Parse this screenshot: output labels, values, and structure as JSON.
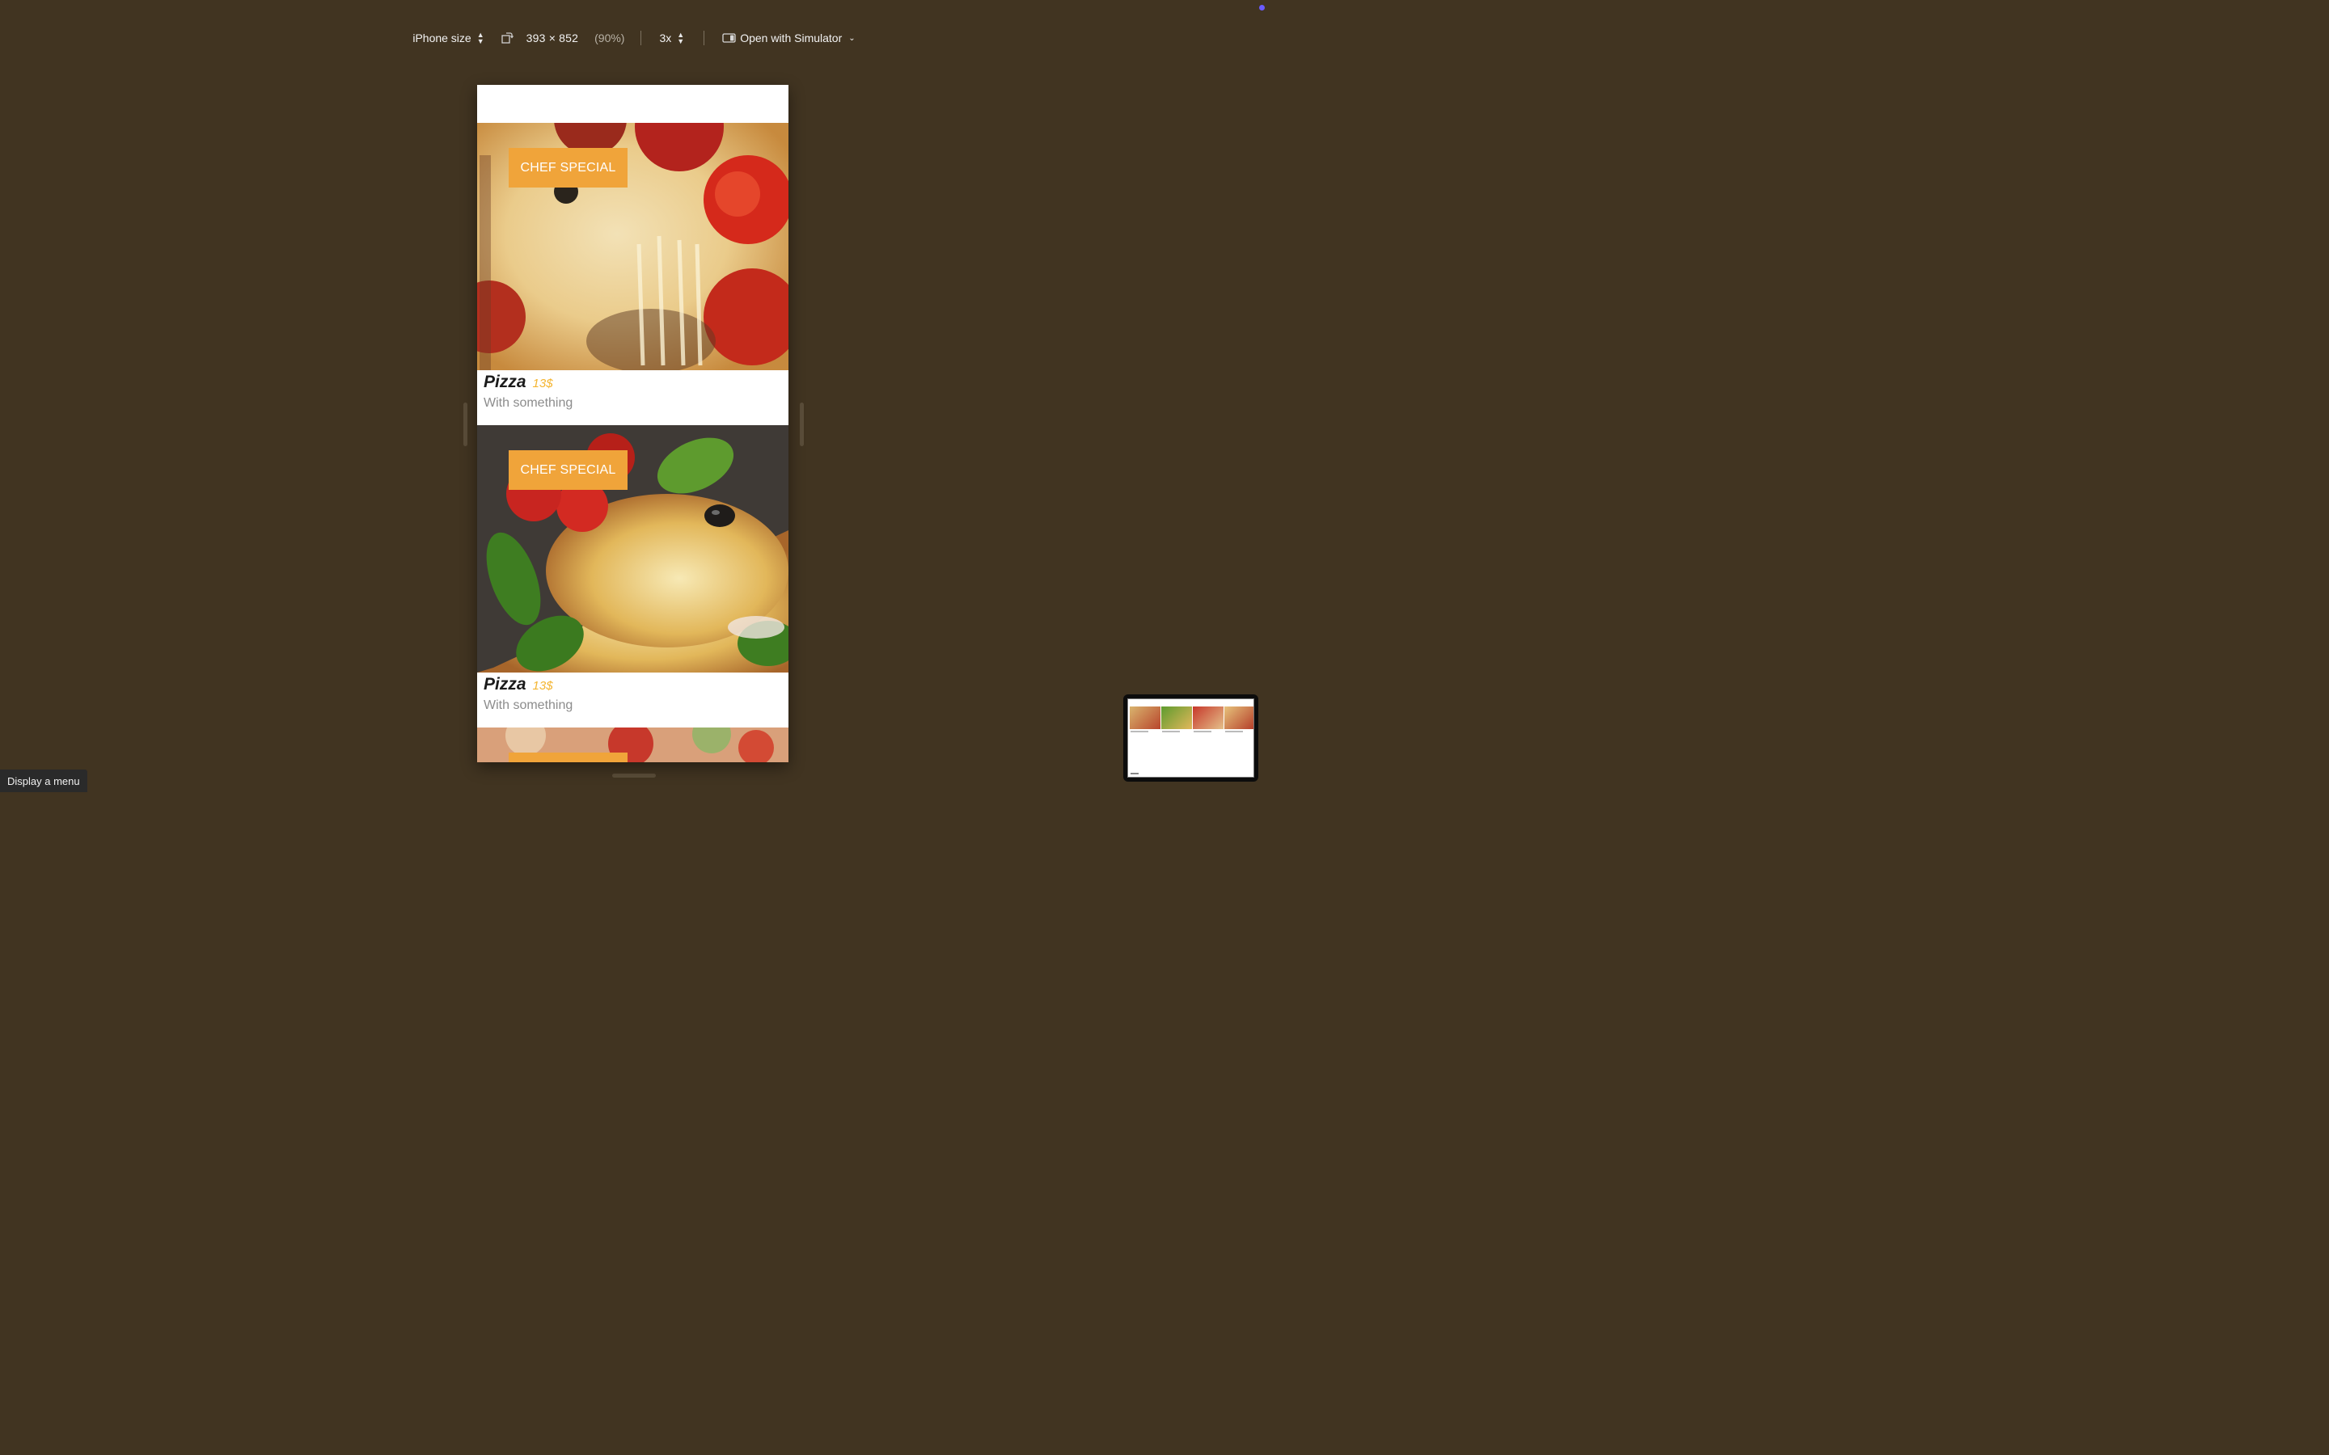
{
  "toolbar": {
    "device_label": "iPhone size",
    "dimensions": "393 × 852",
    "zoom": "(90%)",
    "scale": "3x",
    "open_with": "Open with Simulator"
  },
  "cards": [
    {
      "badge": "CHEF SPECIAL",
      "title": "Pizza",
      "price": "13$",
      "subtitle": "With something"
    },
    {
      "badge": "CHEF SPECIAL",
      "title": "Pizza",
      "price": "13$",
      "subtitle": "With something"
    }
  ],
  "tooltip": "Display a menu",
  "colors": {
    "background": "#413421",
    "badge": "#f0a43a",
    "price": "#f4b531"
  }
}
